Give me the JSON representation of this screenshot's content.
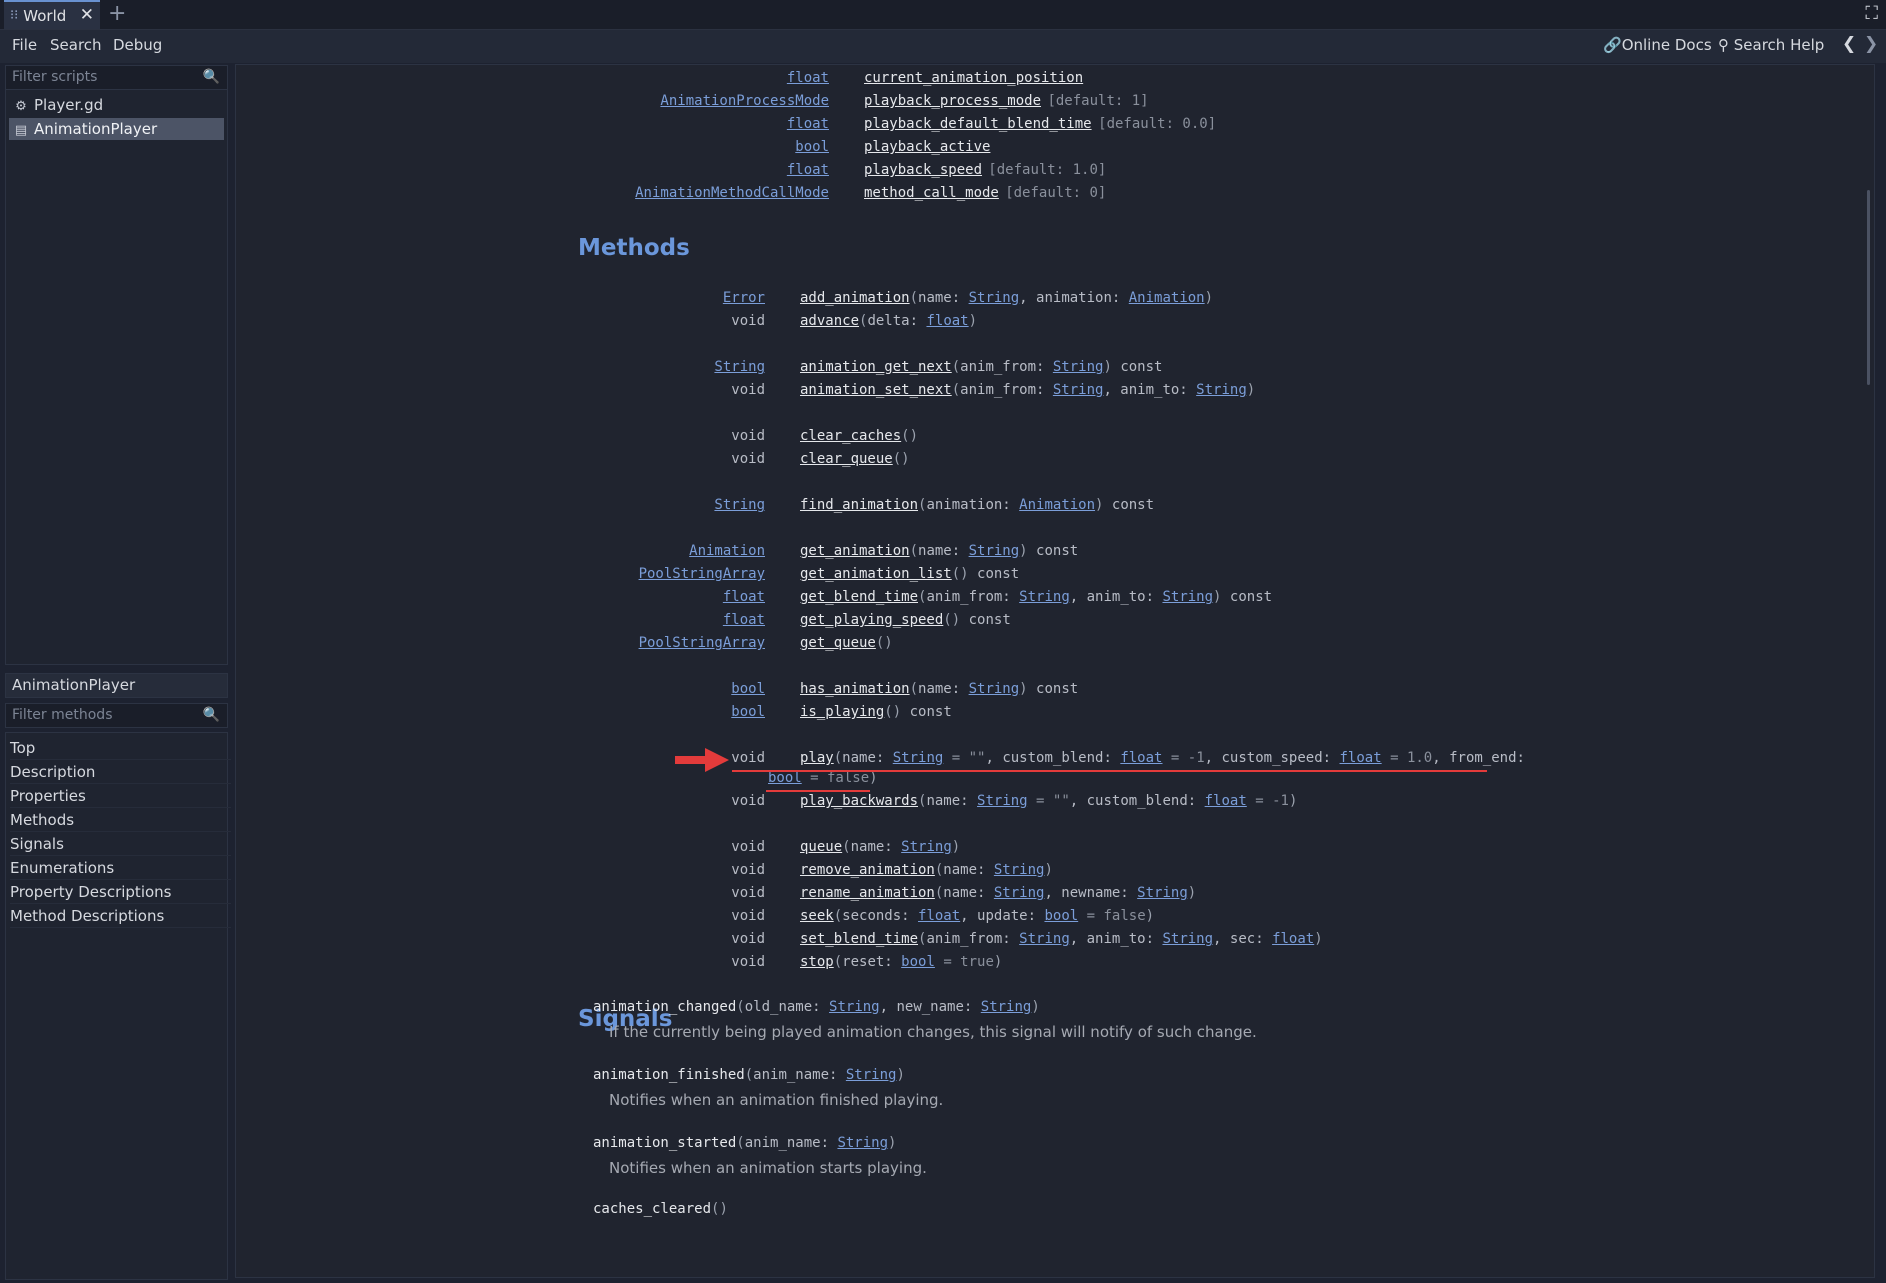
{
  "tab": {
    "title": "World",
    "close": "✕",
    "new": "+"
  },
  "menu": {
    "file": "File",
    "search": "Search",
    "debug": "Debug",
    "online_docs": "Online Docs",
    "search_help": "Search Help"
  },
  "scripts": {
    "filter_placeholder": "Filter scripts",
    "items": [
      {
        "label": "Player.gd",
        "icon": "gear-icon"
      },
      {
        "label": "AnimationPlayer",
        "icon": "doc-icon"
      }
    ]
  },
  "methods_panel": {
    "title": "AnimationPlayer",
    "filter_placeholder": "Filter methods",
    "items": [
      "Top",
      "Description",
      "Properties",
      "Methods",
      "Signals",
      "Enumerations",
      "Property Descriptions",
      "Method Descriptions"
    ]
  },
  "properties": [
    {
      "type": "float",
      "name": "current_animation_position",
      "default": ""
    },
    {
      "type": "AnimationProcessMode",
      "name": "playback_process_mode",
      "default": "[default: 1]"
    },
    {
      "type": "float",
      "name": "playback_default_blend_time",
      "default": "[default: 0.0]"
    },
    {
      "type": "bool",
      "name": "playback_active",
      "default": ""
    },
    {
      "type": "float",
      "name": "playback_speed",
      "default": "[default: 1.0]"
    },
    {
      "type": "AnimationMethodCallMode",
      "name": "method_call_mode",
      "default": "[default: 0]"
    }
  ],
  "headings": {
    "methods": "Methods",
    "signals": "Signals"
  },
  "methods": [
    {
      "ret": "Error",
      "ret_link": true,
      "name": "add_animation",
      "args": [
        [
          "name: ",
          ""
        ],
        [
          "String",
          "L"
        ],
        [
          ", animation: ",
          ""
        ],
        [
          "Animation",
          "L"
        ]
      ],
      "suffix": ""
    },
    {
      "ret": "void",
      "ret_link": false,
      "name": "advance",
      "args": [
        [
          "delta: ",
          ""
        ],
        [
          "float",
          "L"
        ]
      ],
      "suffix": ""
    },
    {
      "ret": "String",
      "ret_link": true,
      "name": "animation_get_next",
      "args": [
        [
          "anim_from: ",
          ""
        ],
        [
          "String",
          "L"
        ]
      ],
      "suffix": " const"
    },
    {
      "ret": "void",
      "ret_link": false,
      "name": "animation_set_next",
      "args": [
        [
          "anim_from: ",
          ""
        ],
        [
          "String",
          "L"
        ],
        [
          ", anim_to: ",
          ""
        ],
        [
          "String",
          "L"
        ]
      ],
      "suffix": ""
    },
    {
      "ret": "void",
      "ret_link": false,
      "name": "clear_caches",
      "args": [],
      "suffix": ""
    },
    {
      "ret": "void",
      "ret_link": false,
      "name": "clear_queue",
      "args": [],
      "suffix": ""
    },
    {
      "ret": "String",
      "ret_link": true,
      "name": "find_animation",
      "args": [
        [
          "animation: ",
          ""
        ],
        [
          "Animation",
          "L"
        ]
      ],
      "suffix": " const"
    },
    {
      "ret": "Animation",
      "ret_link": true,
      "name": "get_animation",
      "args": [
        [
          "name: ",
          ""
        ],
        [
          "String",
          "L"
        ]
      ],
      "suffix": " const"
    },
    {
      "ret": "PoolStringArray",
      "ret_link": true,
      "name": "get_animation_list",
      "args": [],
      "suffix": " const"
    },
    {
      "ret": "float",
      "ret_link": true,
      "name": "get_blend_time",
      "args": [
        [
          "anim_from: ",
          ""
        ],
        [
          "String",
          "L"
        ],
        [
          ", anim_to: ",
          ""
        ],
        [
          "String",
          "L"
        ]
      ],
      "suffix": " const"
    },
    {
      "ret": "float",
      "ret_link": true,
      "name": "get_playing_speed",
      "args": [],
      "suffix": " const"
    },
    {
      "ret": "PoolStringArray",
      "ret_link": true,
      "name": "get_queue",
      "args": [],
      "suffix": ""
    },
    {
      "ret": "bool",
      "ret_link": true,
      "name": "has_animation",
      "args": [
        [
          "name: ",
          ""
        ],
        [
          "String",
          "L"
        ]
      ],
      "suffix": " const"
    },
    {
      "ret": "bool",
      "ret_link": true,
      "name": "is_playing",
      "args": [],
      "suffix": " const"
    },
    {
      "ret": "void",
      "ret_link": false,
      "name": "play",
      "args": [
        [
          "name: ",
          ""
        ],
        [
          "String",
          "L"
        ],
        [
          " = \"\"",
          "G"
        ],
        [
          ", custom_blend: ",
          ""
        ],
        [
          "float",
          "L"
        ],
        [
          " = -1",
          "G"
        ],
        [
          ", custom_speed: ",
          ""
        ],
        [
          "float",
          "L"
        ],
        [
          " = 1.0",
          "G"
        ],
        [
          ", from_end:",
          ""
        ]
      ],
      "suffix": ""
    },
    {
      "ret": "",
      "ret_link": false,
      "name": "",
      "args": [
        [
          "bool",
          "L"
        ],
        [
          " = false",
          "G"
        ]
      ],
      "suffix": "",
      "continuation": true
    },
    {
      "ret": "void",
      "ret_link": false,
      "name": "play_backwards",
      "args": [
        [
          "name: ",
          ""
        ],
        [
          "String",
          "L"
        ],
        [
          " = \"\"",
          "G"
        ],
        [
          ", custom_blend: ",
          ""
        ],
        [
          "float",
          "L"
        ],
        [
          " = -1",
          "G"
        ]
      ],
      "suffix": ""
    },
    {
      "ret": "void",
      "ret_link": false,
      "name": "queue",
      "args": [
        [
          "name: ",
          ""
        ],
        [
          "String",
          "L"
        ]
      ],
      "suffix": ""
    },
    {
      "ret": "void",
      "ret_link": false,
      "name": "remove_animation",
      "args": [
        [
          "name: ",
          ""
        ],
        [
          "String",
          "L"
        ]
      ],
      "suffix": ""
    },
    {
      "ret": "void",
      "ret_link": false,
      "name": "rename_animation",
      "args": [
        [
          "name: ",
          ""
        ],
        [
          "String",
          "L"
        ],
        [
          ", newname: ",
          ""
        ],
        [
          "String",
          "L"
        ]
      ],
      "suffix": ""
    },
    {
      "ret": "void",
      "ret_link": false,
      "name": "seek",
      "args": [
        [
          "seconds: ",
          ""
        ],
        [
          "float",
          "L"
        ],
        [
          ", update: ",
          ""
        ],
        [
          "bool",
          "L"
        ],
        [
          " = false",
          "G"
        ]
      ],
      "suffix": ""
    },
    {
      "ret": "void",
      "ret_link": false,
      "name": "set_blend_time",
      "args": [
        [
          "anim_from: ",
          ""
        ],
        [
          "String",
          "L"
        ],
        [
          ", anim_to: ",
          ""
        ],
        [
          "String",
          "L"
        ],
        [
          ", sec: ",
          ""
        ],
        [
          "float",
          "L"
        ]
      ],
      "suffix": ""
    },
    {
      "ret": "void",
      "ret_link": false,
      "name": "stop",
      "args": [
        [
          "reset: ",
          ""
        ],
        [
          "bool",
          "L"
        ],
        [
          " = true",
          "G"
        ]
      ],
      "suffix": ""
    }
  ],
  "signals": [
    {
      "name": "animation_changed",
      "args": [
        [
          "old_name: ",
          ""
        ],
        [
          "String",
          "L"
        ],
        [
          ", new_name: ",
          ""
        ],
        [
          "String",
          "L"
        ]
      ],
      "desc": "If the currently being played animation changes, this signal will notify of such change."
    },
    {
      "name": "animation_finished",
      "args": [
        [
          "anim_name: ",
          ""
        ],
        [
          "String",
          "L"
        ]
      ],
      "desc": "Notifies when an animation finished playing."
    },
    {
      "name": "animation_started",
      "args": [
        [
          "anim_name: ",
          ""
        ],
        [
          "String",
          "L"
        ]
      ],
      "desc": "Notifies when an animation starts playing."
    },
    {
      "name": "caches_cleared",
      "args": [],
      "desc": ""
    }
  ],
  "colors": {
    "accent": "#6b97db",
    "link": "#7b9ed9",
    "annotation": "#e33b3b"
  }
}
